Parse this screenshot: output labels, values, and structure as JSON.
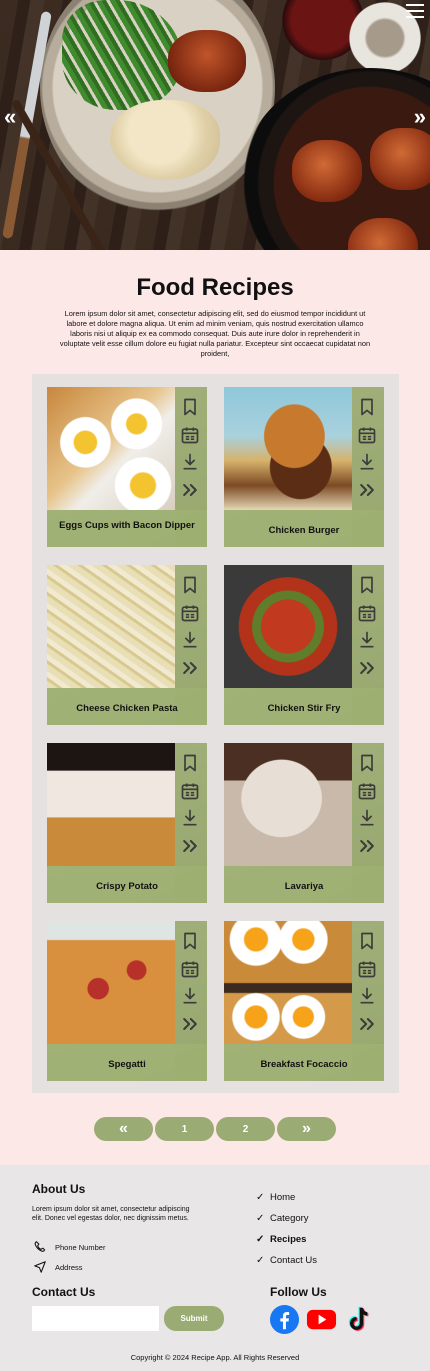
{
  "hero": {
    "prev_icon": "double-chevron-left-icon",
    "next_icon": "double-chevron-right-icon",
    "menu_icon": "hamburger-menu-icon",
    "prev_glyph": "«",
    "next_glyph": "»"
  },
  "page_title": "Food Recipes",
  "intro": "Lorem ipsum dolor sit amet, consectetur adipiscing elit, sed do eiusmod tempor incididunt ut labore et dolore magna aliqua. Ut enim ad minim veniam, quis nostrud exercitation ullamco laboris nisi ut aliquip ex ea commodo consequat. Duis aute irure dolor in reprehenderit in voluptate velit esse cillum dolore eu fugiat nulla pariatur. Excepteur sint occaecat cupidatat non proident,",
  "recipes": [
    {
      "name": "Eggs Cups with Bacon Dipper"
    },
    {
      "name": "Chicken Burger"
    },
    {
      "name": "Cheese Chicken Pasta"
    },
    {
      "name": "Chicken Stir Fry"
    },
    {
      "name": "Crispy Potato"
    },
    {
      "name": "Lavariya"
    },
    {
      "name": "Spegatti"
    },
    {
      "name": "Breakfast Focaccio"
    }
  ],
  "card_icons": [
    "bookmark-icon",
    "calendar-icon",
    "download-icon",
    "double-chevron-right-icon"
  ],
  "pagination": {
    "prev": "«",
    "pages": [
      "1",
      "2"
    ],
    "next": "»"
  },
  "footer": {
    "about_title": "About Us",
    "about_text": "Lorem ipsum dolor sit amet, consectetur adipiscing elit. Donec vel egestas dolor, nec dignissim metus.",
    "phone_label": "Phone Number",
    "address_label": "Address",
    "nav": [
      {
        "label": "Home",
        "active": false
      },
      {
        "label": "Category",
        "active": false
      },
      {
        "label": "Recipes",
        "active": true
      },
      {
        "label": "Contact Us",
        "active": false
      }
    ],
    "contact_title": "Contact Us",
    "email_placeholder": "",
    "submit_label": "Submit",
    "follow_title": "Follow Us",
    "socials": [
      "facebook-icon",
      "youtube-icon",
      "tiktok-icon"
    ],
    "copyright": "Copyright © 2024 Recipe App. All Rights Reserved"
  },
  "colors": {
    "page_bg": "#fde8e8",
    "accent_green": "#9aab73",
    "grid_bg": "#e4e1e0",
    "footer_bg": "#e8e6e6"
  }
}
